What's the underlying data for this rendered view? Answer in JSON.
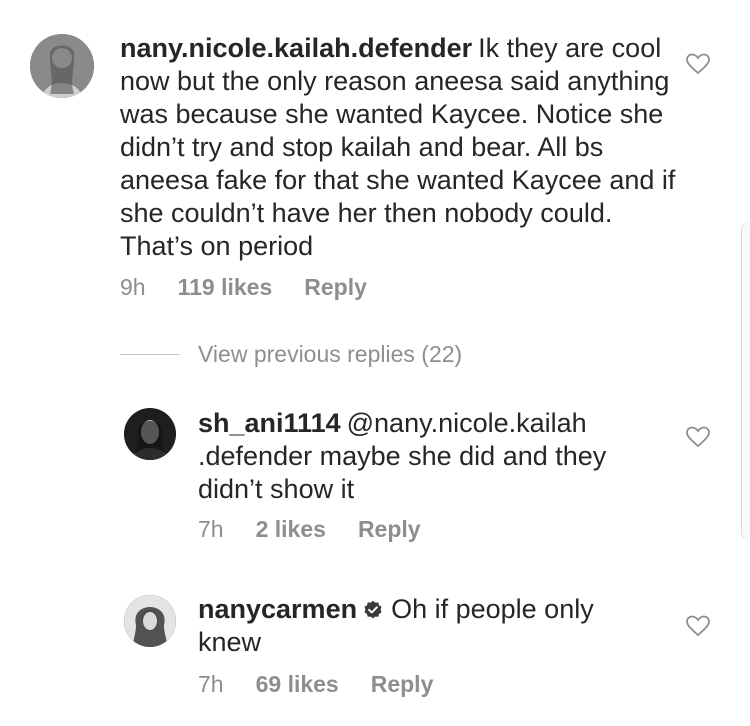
{
  "comments": [
    {
      "username": "nany.nicole.kailah.defender",
      "body": "Ik they are cool now but the only reason aneesa said anything was because she wanted Kaycee. Notice she didn’t try and stop kailah and bear. All bs aneesa fake for that she wanted Kaycee and if she couldn’t have her then nobody could. That’s on period",
      "time": "9h",
      "likes": "119 likes",
      "reply": "Reply"
    }
  ],
  "view_previous_replies": "View previous replies (22)",
  "replies": [
    {
      "username": "sh_ani1114",
      "body": "@nany.nicole.kailah .defender maybe she did and they didn’t show it",
      "time": "7h",
      "likes": "2 likes",
      "reply": "Reply"
    },
    {
      "username": "nanycarmen",
      "verified": true,
      "body": "Oh if people only knew",
      "time": "7h",
      "likes": "69 likes",
      "reply": "Reply"
    }
  ]
}
